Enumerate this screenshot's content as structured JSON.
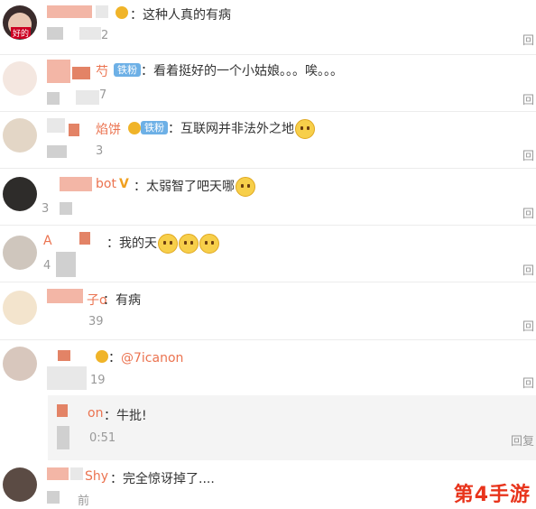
{
  "comments": [
    {
      "name_tail": "",
      "text": "这种人真的有病",
      "meta": "2",
      "reply": "回"
    },
    {
      "name_tail": "芍",
      "badge": "铁粉",
      "text": "看着挺好的一个小姑娘。。。唉。。。",
      "meta": "7",
      "reply": "回"
    },
    {
      "name_tail": "焰饼",
      "badge": "铁粉",
      "text": "互联网并非法外之地",
      "meta": "3",
      "reply": "回"
    },
    {
      "name_tail": "bot",
      "text": "太弱智了吧天哪",
      "meta": "3",
      "reply": "回"
    },
    {
      "name_tail": "A",
      "text": "我的天",
      "meta": "4",
      "reply": "回"
    },
    {
      "name_tail": "子o",
      "text": "有病",
      "meta": "39",
      "reply": "回"
    },
    {
      "name_tail": "",
      "mention": "@7icanon",
      "meta": "19",
      "reply": "回"
    },
    {
      "name_tail": "Shy",
      "text": "完全惊讶掉了....",
      "meta": "前",
      "reply": ""
    }
  ],
  "sub_reply": {
    "name_tail": "on",
    "text": "牛批!",
    "meta": "0:51",
    "reply": "回复"
  },
  "avatar_caption": "好的",
  "watermark": "第4手游"
}
